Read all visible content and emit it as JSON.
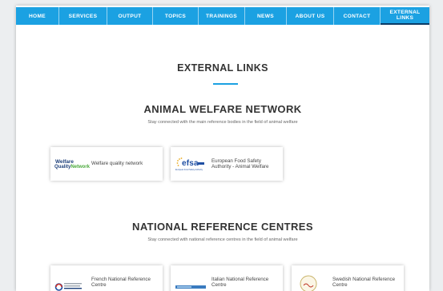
{
  "nav": {
    "items": [
      "Home",
      "Services",
      "Output",
      "Topics",
      "Trainings",
      "News",
      "About us",
      "Contact",
      "External\nLinks"
    ]
  },
  "page": {
    "title": "EXTERNAL LINKS"
  },
  "animal_welfare": {
    "title": "ANIMAL WELFARE NETWORK",
    "subtitle": "Stay connected with the main reference bodies in the field of animal welfare",
    "cards": [
      {
        "label": "Welfare quality network",
        "logo_text_top": "Welfare",
        "logo_text_bottom_a": "Quality",
        "logo_text_bottom_b": "Network"
      },
      {
        "label": "European Food Safety Authority - Animal Welfare",
        "logo_text": "efsa",
        "logo_caption": "European Food Safety Authority"
      }
    ]
  },
  "national": {
    "title": "NATIONAL REFERENCE CENTRES",
    "subtitle": "Stay connected with national reference centres in the field of animal welfare",
    "cards": [
      {
        "label": "French National Reference Centre"
      },
      {
        "label": "Italian National Reference Centre"
      },
      {
        "label": "Swedish National Reference Centre"
      }
    ]
  },
  "colors": {
    "accent": "#1ba1e2",
    "nav_active_border": "#0b3b66",
    "heading": "#333333",
    "body_text": "#666666",
    "logo_dark_blue": "#1d3f7a",
    "logo_green": "#4aa93b",
    "efsa_blue": "#1f4fa3",
    "efsa_yellow": "#e9a91c"
  }
}
